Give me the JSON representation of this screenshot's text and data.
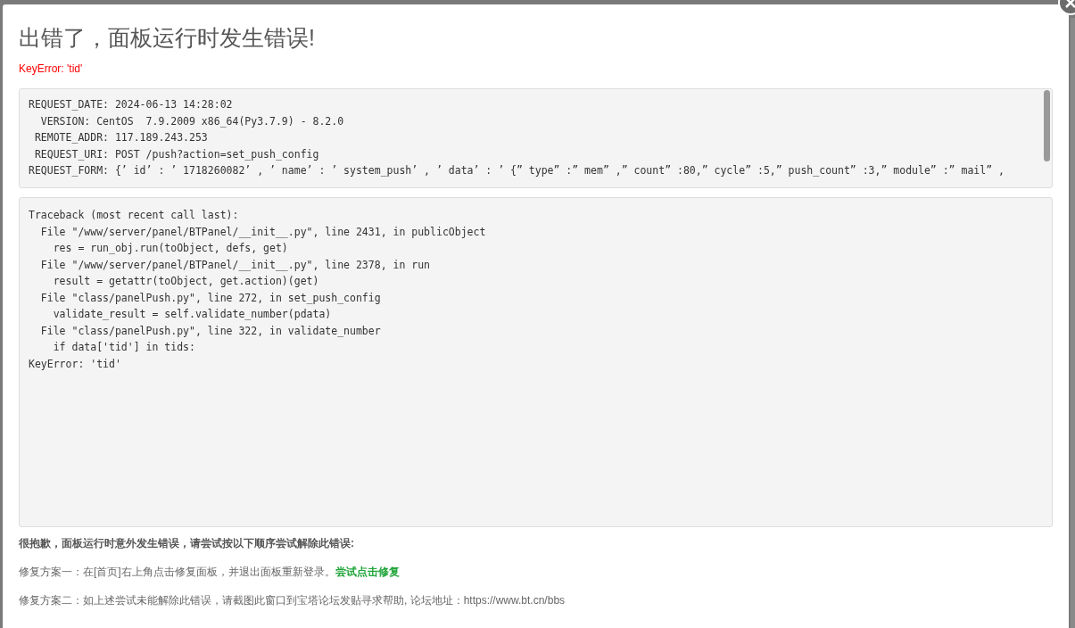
{
  "dialog": {
    "title": "出错了，面板运行时发生错误!",
    "error_summary": "KeyError: 'tid'",
    "request_info": [
      "REQUEST_DATE: 2024-06-13 14:28:02",
      "  VERSION: CentOS  7.9.2009 x86_64(Py3.7.9) - 8.2.0",
      " REMOTE_ADDR: 117.189.243.253",
      " REQUEST_URI: POST /push?action=set_push_config",
      "REQUEST_FORM: {’ id’ : ’ 1718260082’ , ’ name’ : ’ system_push’ , ’ data’ : ’ {” type” :” mem” ,” count” :80,” cycle” :5,” push_count” :3,” module” :” mail” ,"
    ],
    "traceback": [
      "Traceback (most recent call last):",
      "  File \"/www/server/panel/BTPanel/__init__.py\", line 2431, in publicObject",
      "    res = run_obj.run(toObject, defs, get)",
      "  File \"/www/server/panel/BTPanel/__init__.py\", line 2378, in run",
      "    result = getattr(toObject, get.action)(get)",
      "  File \"class/panelPush.py\", line 272, in set_push_config",
      "    validate_result = self.validate_number(pdata)",
      "  File \"class/panelPush.py\", line 322, in validate_number",
      "    if data['tid'] in tids:",
      "KeyError: 'tid'"
    ],
    "help_heading": "很抱歉，面板运行时意外发生错误，请尝试按以下顺序尝试解除此错误:",
    "fixes": [
      {
        "text": "修复方案一：在[首页]右上角点击修复面板，并退出面板重新登录。",
        "link": "尝试点击修复"
      },
      {
        "text": "修复方案二：如上述尝试未能解除此错误，请截图此窗口到宝塔论坛发贴寻求帮助, 论坛地址：https://www.bt.cn/bbs"
      }
    ]
  }
}
